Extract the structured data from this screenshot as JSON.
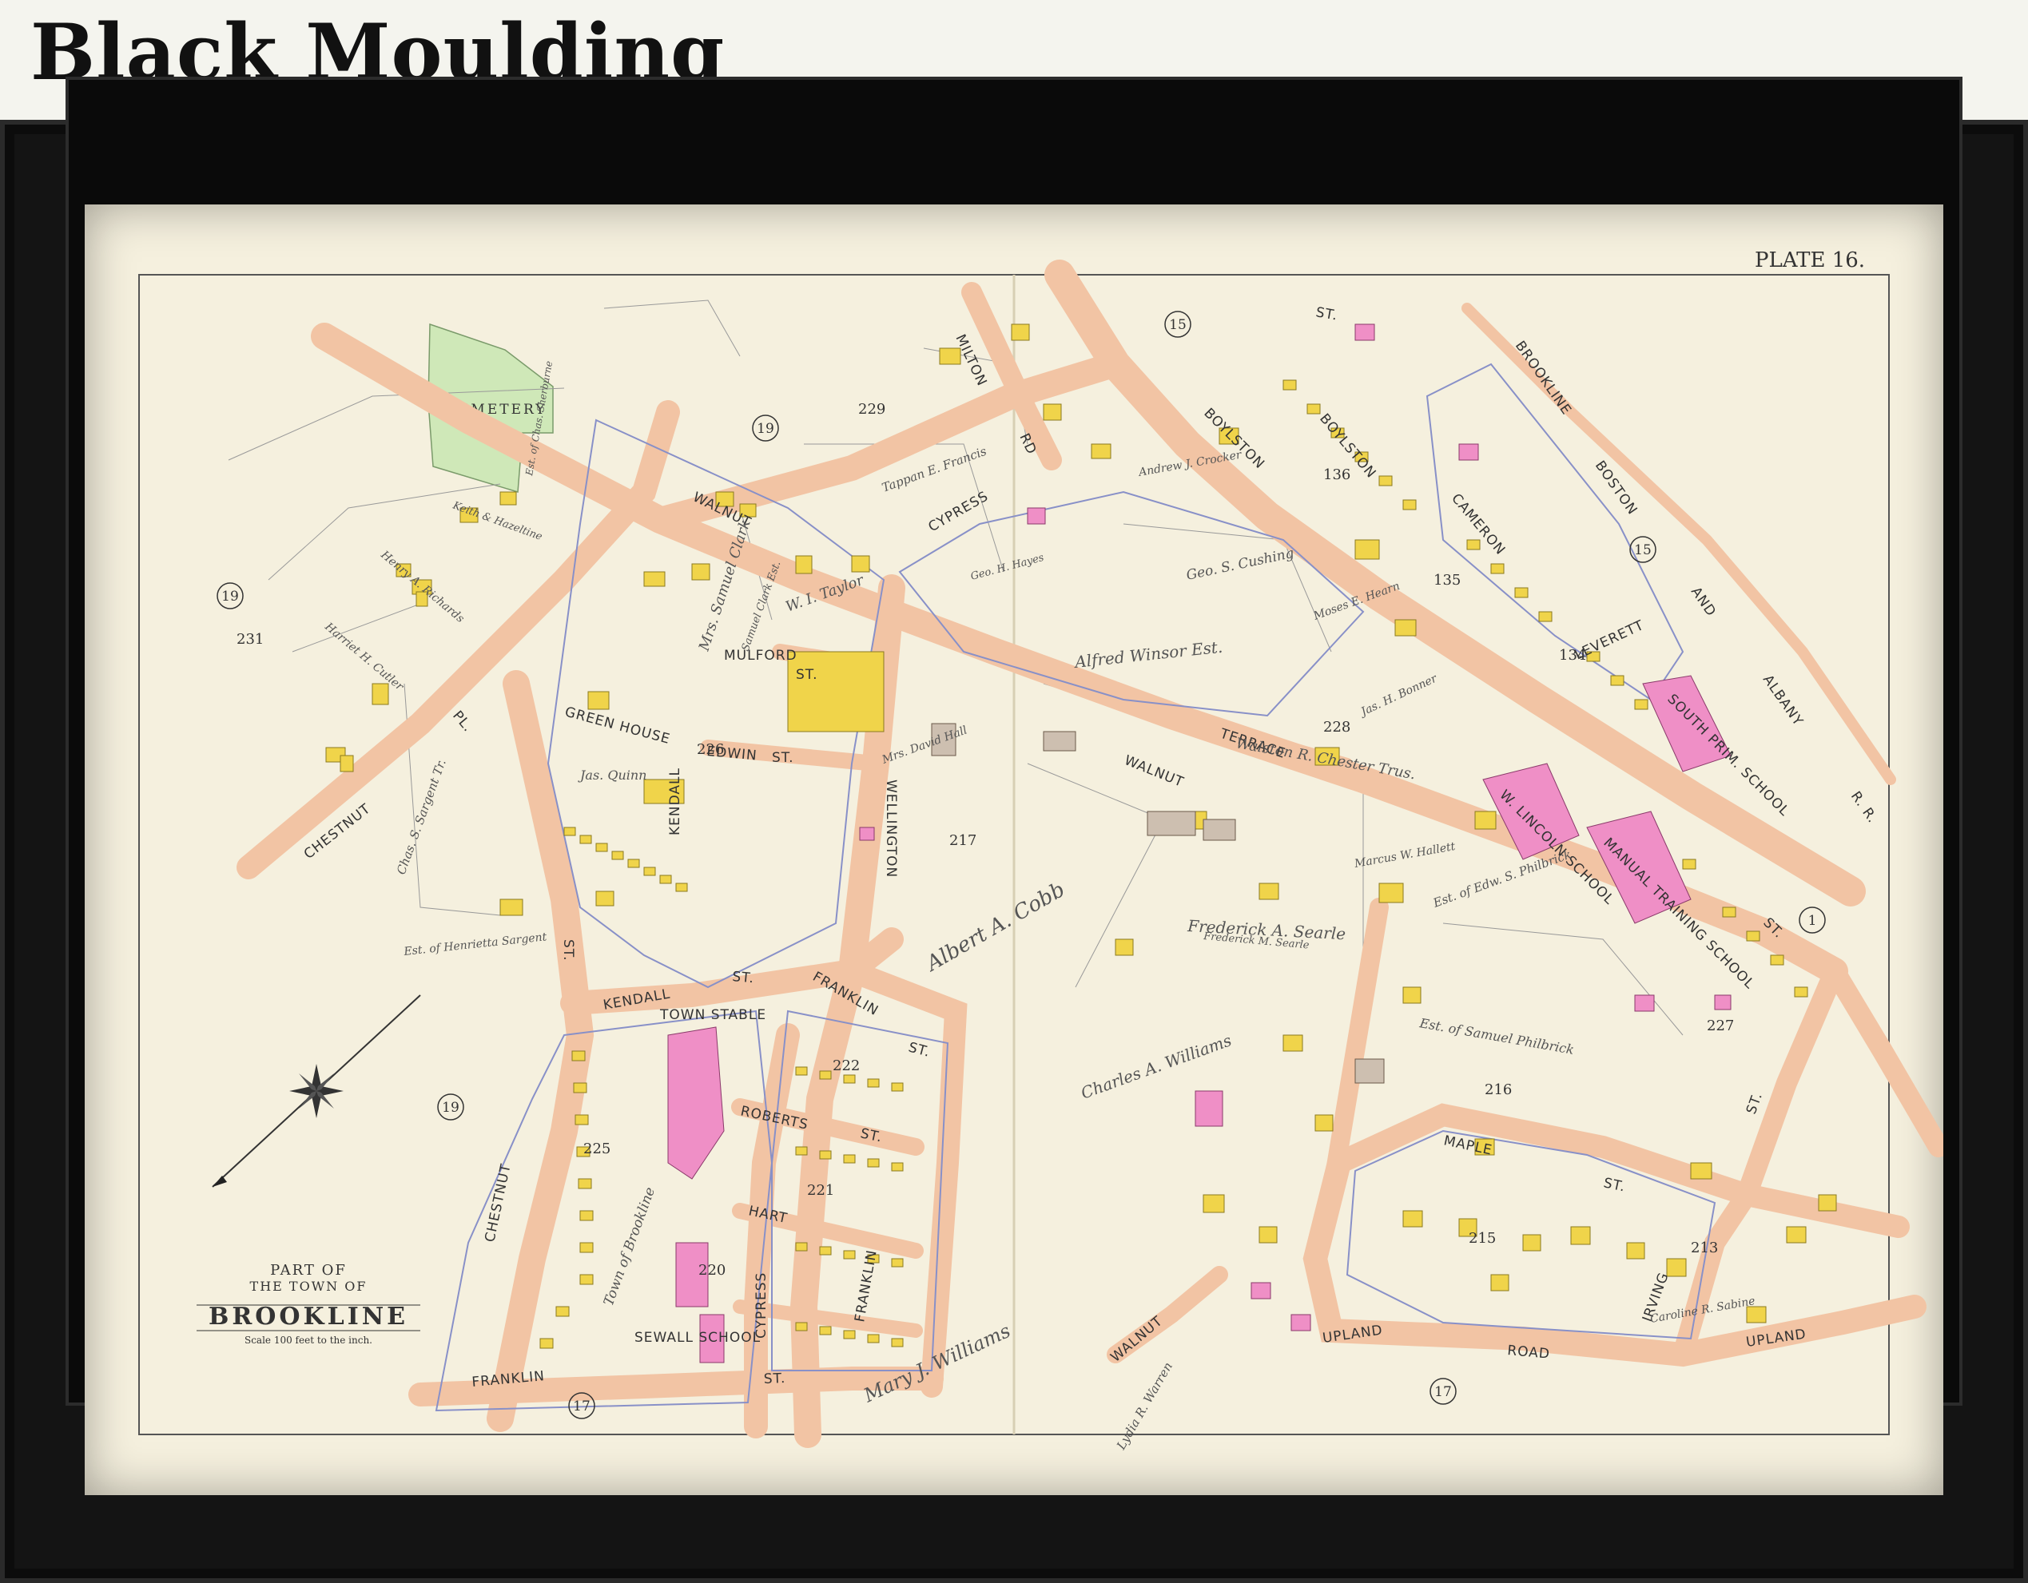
{
  "header": {
    "title": "Black Moulding"
  },
  "map": {
    "plate": "PLATE 16.",
    "cartouche": {
      "line1": "PART OF",
      "line2": "THE TOWN OF",
      "line3": "BROOKLINE",
      "scale": "Scale 100 feet to the inch."
    },
    "areas": {
      "cemetery": "CEMETERY"
    },
    "plate_refs": [
      "19",
      "19",
      "19",
      "15",
      "15",
      "1",
      "17",
      "17"
    ],
    "block_numbers": [
      "229",
      "231",
      "226",
      "217",
      "225",
      "222",
      "221",
      "220",
      "228",
      "216",
      "215",
      "213",
      "135",
      "136",
      "134",
      "227"
    ],
    "streets": {
      "walnut": "WALNUT",
      "walnut2": "WALNUT",
      "walnut3": "WALNUT",
      "cypress": "CYPRESS",
      "cypress2": "CYPRESS",
      "boylston": "BOYLSTON",
      "boylston2": "BOYLSTON",
      "st_top": "ST.",
      "chestnut_pl": "CHESTNUT",
      "pl": "PL.",
      "chestnut_st": "CHESTNUT",
      "kendall": "KENDALL",
      "kendall2": "KENDALL",
      "franklin": "FRANKLIN",
      "franklin2": "FRANKLIN",
      "franklin3": "FRANKLIN",
      "milton": "MILTON",
      "rd": "RD",
      "mulford": "MULFORD",
      "edwin": "EDWIN",
      "wellington": "WELLINGTON",
      "roberts": "ROBERTS",
      "hart": "HART",
      "maple": "MAPLE",
      "upland": "UPLAND",
      "upland2": "UPLAND",
      "road": "ROAD",
      "irving": "IRVING",
      "cameron": "CAMERON",
      "leverett": "LEVERETT",
      "terrace": "TERRACE",
      "brookline": "BROOKLINE",
      "boston": "BOSTON",
      "albany": "ALBANY",
      "and": "AND",
      "rr": "R. R.",
      "st_a": "ST.",
      "st_b": "ST.",
      "st_c": "ST.",
      "st_d": "ST.",
      "st_e": "ST.",
      "st_f": "ST.",
      "st_g": "ST.",
      "st_h": "ST.",
      "st_i": "ST.",
      "st_j": "ST."
    },
    "schools": {
      "lincoln": "W. LINCOLN SCHOOL",
      "manual": "MANUAL TRAINING SCHOOL",
      "south": "SOUTH PRIM. SCHOOL",
      "sewall": "SEWALL SCHOOL",
      "stable": "TOWN STABLE",
      "green": "GREEN HOUSE"
    },
    "owners": {
      "o1": "Alfred Winsor Est.",
      "o2": "Geo. S. Cushing",
      "o3": "Walston R. Chester Trus.",
      "o4": "Frederick A. Searle",
      "o5": "Charles A. Williams",
      "o6": "Mary J. Williams",
      "o7": "Albert A. Cobb",
      "o8": "Jas. Quinn",
      "o9": "Mrs. Samuel Clark",
      "o10": "W. I. Taylor",
      "o11": "Est. of Samuel Philbrick",
      "o12": "Est. of Henrietta Sargent",
      "o13": "Chas. S. Sargent Tr.",
      "o14": "Tappan E. Francis",
      "o15": "Town of Brookline",
      "o16": "Lydia R. Warren",
      "o17": "Henry A. Richards",
      "o18": "Harriet H. Cutler",
      "o19": "Keith & Hazeltine",
      "o20": "Est. of Edw. S. Philbrick",
      "o21": "Marcus W. Hallett",
      "o22": "Jas. H. Bonner",
      "o23": "Mrs. David Hall",
      "o24": "Caroline R. Sabine",
      "o25": "Frederick M. Searle",
      "o26": "Moses E. Hearn",
      "o27": "Samuel Clark Est.",
      "o28": "Geo. H. Hayes",
      "o29": "Est. of Chas. Sherburne",
      "o30": "Andrew J. Crocker"
    }
  },
  "colors": {
    "lot": "#f0d44a",
    "public": "#ef8fc6",
    "cemetery": "#cfe8b8",
    "road": "#f2c4a4",
    "paper": "#f5f0de",
    "frame": "#141414"
  }
}
